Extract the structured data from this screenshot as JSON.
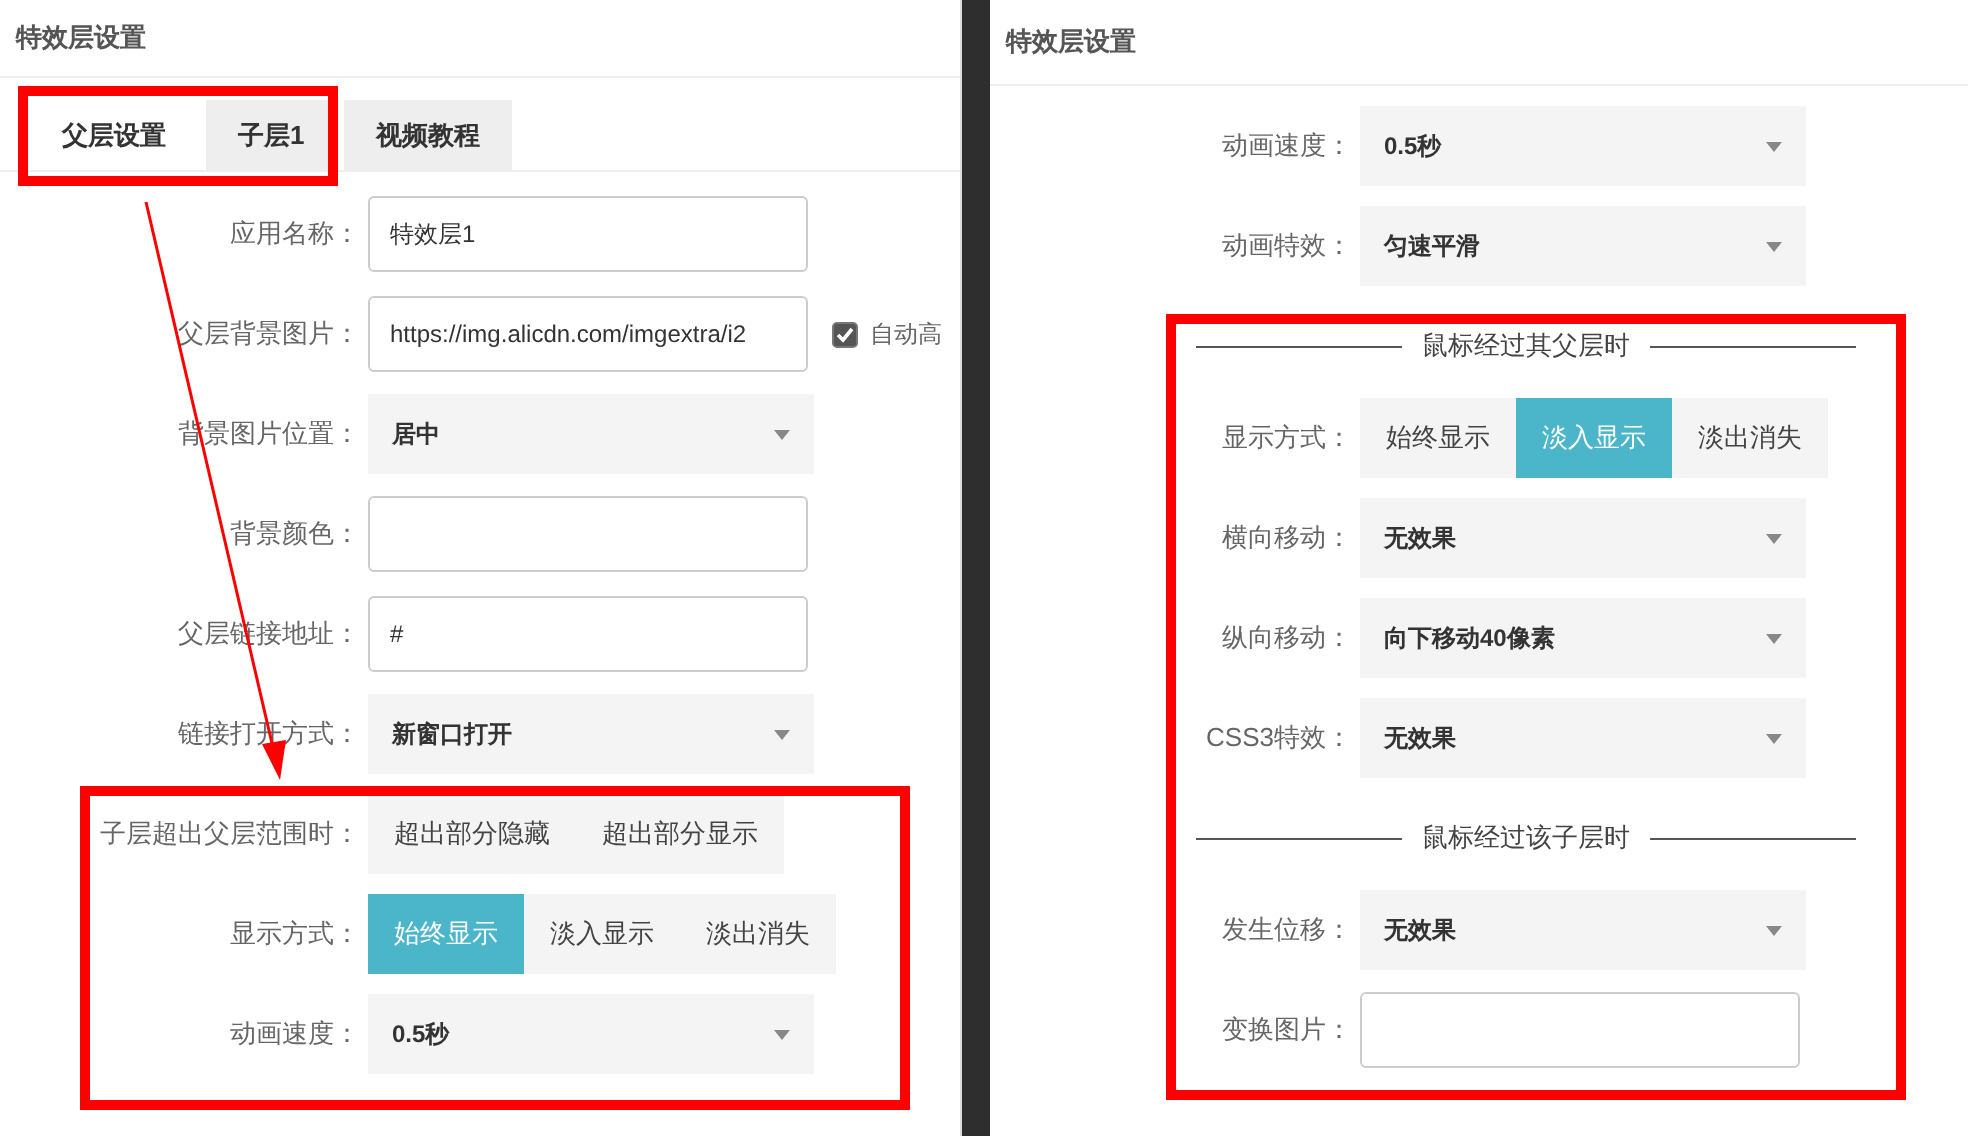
{
  "left_panel": {
    "title": "特效层设置",
    "tabs": [
      {
        "label": "父层设置",
        "selected": true
      },
      {
        "label": "子层1",
        "selected": false
      },
      {
        "label": "视频教程",
        "selected": false
      }
    ],
    "rows": [
      {
        "kind": "input",
        "label": "应用名称：",
        "value": "特效层1"
      },
      {
        "kind": "input",
        "label": "父层背景图片：",
        "value": "https://img.alicdn.com/imgextra/i2",
        "checkbox": {
          "label": "自动高",
          "checked": true
        }
      },
      {
        "kind": "select",
        "label": "背景图片位置：",
        "value": "居中"
      },
      {
        "kind": "input",
        "label": "背景颜色："
      },
      {
        "kind": "input",
        "label": "父层链接地址：",
        "value": "#"
      },
      {
        "kind": "select",
        "label": "链接打开方式：",
        "value": "新窗口打开"
      },
      {
        "kind": "segmented",
        "label": "子层超出父层范围时：",
        "options": [
          {
            "label": "超出部分隐藏",
            "selected": false
          },
          {
            "label": "超出部分显示",
            "selected": false
          }
        ]
      },
      {
        "kind": "segmented",
        "label": "显示方式：",
        "options": [
          {
            "label": "始终显示",
            "selected": true
          },
          {
            "label": "淡入显示",
            "selected": false
          },
          {
            "label": "淡出消失",
            "selected": false
          }
        ]
      },
      {
        "kind": "select",
        "label": "动画速度：",
        "value": "0.5秒"
      }
    ]
  },
  "right_panel": {
    "title": "特效层设置",
    "rows": [
      {
        "kind": "select",
        "label": "动画速度：",
        "value": "0.5秒"
      },
      {
        "kind": "select",
        "label": "动画特效：",
        "value": "匀速平滑"
      },
      {
        "kind": "heading",
        "label": "鼠标经过其父层时"
      },
      {
        "kind": "segmented",
        "label": "显示方式：",
        "options": [
          {
            "label": "始终显示",
            "selected": false
          },
          {
            "label": "淡入显示",
            "selected": true
          },
          {
            "label": "淡出消失",
            "selected": false
          }
        ]
      },
      {
        "kind": "select",
        "label": "横向移动：",
        "value": "无效果"
      },
      {
        "kind": "select",
        "label": "纵向移动：",
        "value": "向下移动40像素"
      },
      {
        "kind": "select",
        "label": "CSS3特效：",
        "value": "无效果"
      },
      {
        "kind": "heading",
        "label": "鼠标经过该子层时"
      },
      {
        "kind": "select",
        "label": "发生位移：",
        "value": "无效果"
      },
      {
        "kind": "input",
        "label": "变换图片："
      }
    ]
  }
}
